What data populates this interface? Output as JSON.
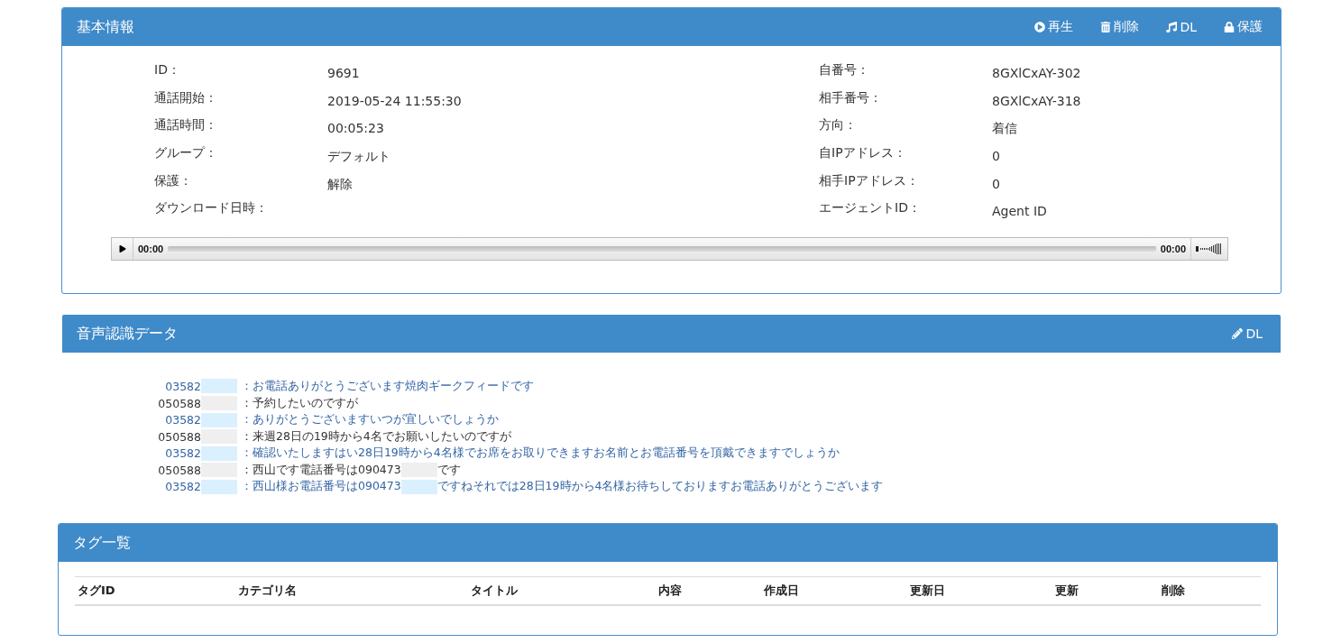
{
  "basic_info": {
    "title": "基本情報",
    "actions": [
      {
        "kind": "play",
        "label": "再生"
      },
      {
        "kind": "trash",
        "label": "削除"
      },
      {
        "kind": "music",
        "label": "DL"
      },
      {
        "kind": "lock",
        "label": "保護"
      }
    ],
    "left_fields": [
      {
        "label": "ID：",
        "value": "9691"
      },
      {
        "label": "通話開始：",
        "value": "2019-05-24 11:55:30"
      },
      {
        "label": "通話時間：",
        "value": "00:05:23"
      },
      {
        "label": "グループ：",
        "value": "デフォルト"
      },
      {
        "label": "保護：",
        "value": "解除"
      },
      {
        "label": "ダウンロード日時："
      }
    ],
    "right_fields": [
      {
        "label": "自番号：",
        "value": "8GXlCxAY-302"
      },
      {
        "label": "相手番号：",
        "value": "8GXlCxAY-318"
      },
      {
        "label": "方向：",
        "value": "着信"
      },
      {
        "label": "自IPアドレス：",
        "value": "0"
      },
      {
        "label": "相手IPアドレス：",
        "value": "0"
      },
      {
        "label": "エージェントID：",
        "value": "Agent ID"
      }
    ],
    "player": {
      "elapsed": "00:00",
      "duration": "00:00"
    }
  },
  "speech_recognition": {
    "title": "音声認識データ",
    "action": {
      "kind": "pencil",
      "label": "DL"
    },
    "lines": [
      {
        "kind": "agent",
        "speaker": "03582",
        "text": "：お電話ありがとうございます焼肉ギークフィードです"
      },
      {
        "kind": "caller",
        "speaker": "050588",
        "text": "：予約したいのですが"
      },
      {
        "kind": "agent",
        "speaker": "03582",
        "text": "：ありがとうございますいつが宜しいでしょうか"
      },
      {
        "kind": "caller",
        "speaker": "050588",
        "text": "：来週28日の19時から4名でお願いしたいのですが"
      },
      {
        "kind": "agent",
        "speaker": "03582",
        "text": "：確認いたしますはい28日19時から4名様でお席をお取りできますお名前とお電話番号を頂戴できますでしょうか"
      },
      {
        "kind": "caller",
        "speaker": "050588",
        "text": "：西山です電話番号は090473",
        "text_after": "です"
      },
      {
        "kind": "agent",
        "speaker": "03582",
        "text": "：西山様お電話番号は090473",
        "text_after": "ですねそれでは28日19時から4名様お待ちしておりますお電話ありがとうございます"
      }
    ]
  },
  "tags": {
    "title": "タグ一覧",
    "columns": [
      "タグID",
      "カテゴリ名",
      "タイトル",
      "内容",
      "作成日",
      "更新日",
      "更新",
      "削除"
    ]
  }
}
